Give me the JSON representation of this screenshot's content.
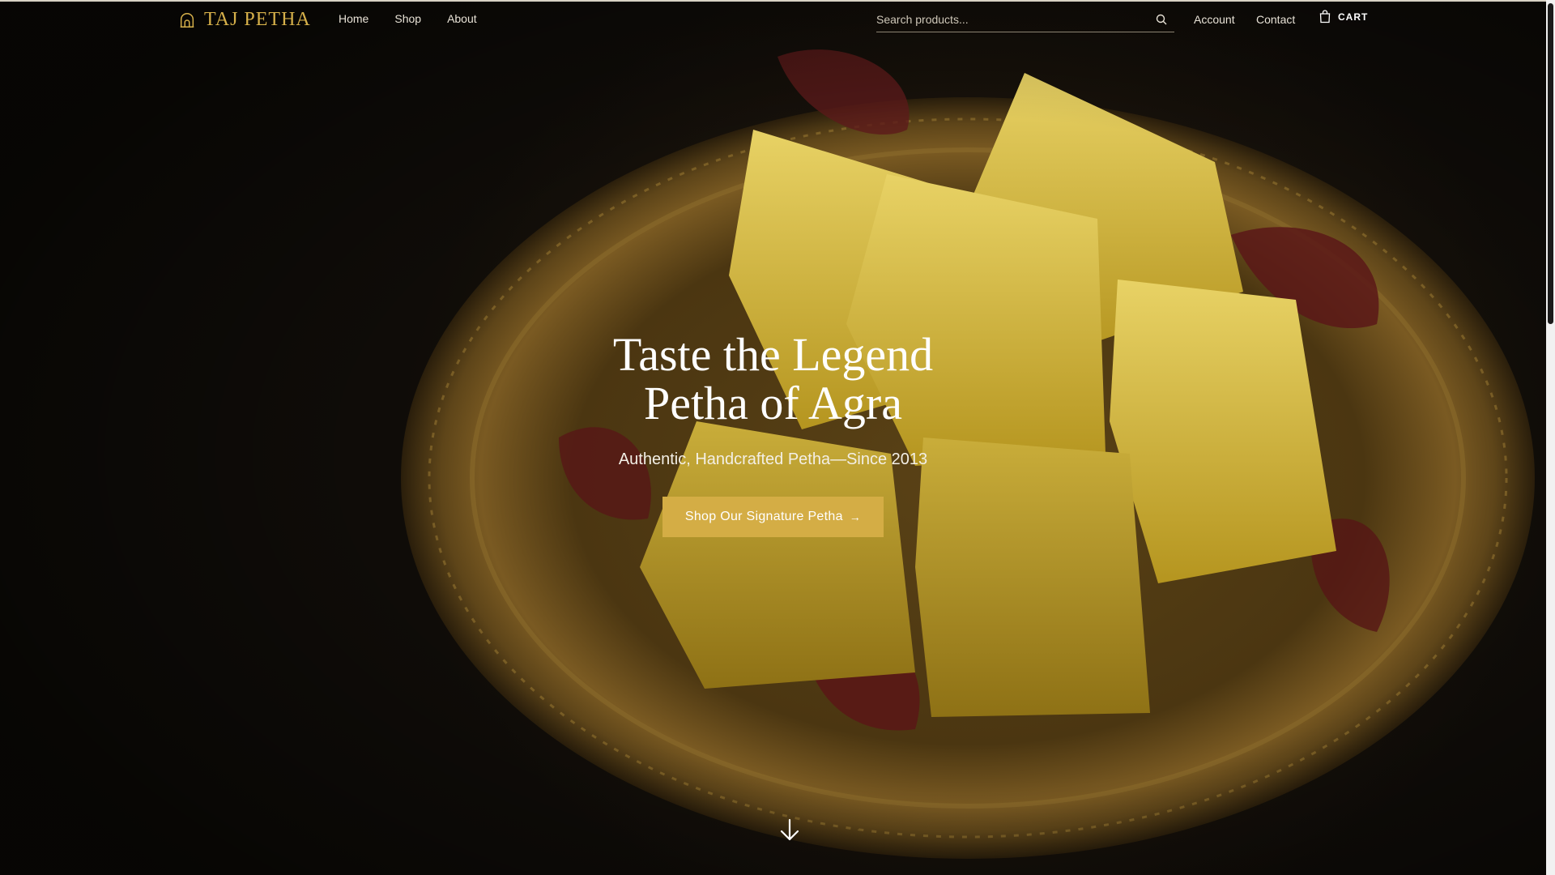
{
  "brand": {
    "name": "TAJ PETHA",
    "logo_icon": "temple-arch-icon",
    "color": "#d6b04a"
  },
  "nav": {
    "links": [
      {
        "label": "Home"
      },
      {
        "label": "Shop"
      },
      {
        "label": "About"
      }
    ]
  },
  "search": {
    "placeholder": "Search products...",
    "icon": "search-icon"
  },
  "header_right": {
    "account_label": "Account",
    "contact_label": "Contact",
    "cart_label": "CART",
    "cart_icon": "shopping-bag-icon"
  },
  "hero": {
    "headline_line1": "Taste the Legend",
    "headline_line2": "Petha of Agra",
    "subheadline": "Authentic, Handcrafted Petha—Since 2013",
    "cta_label": "Shop Our Signature Petha",
    "cta_arrow": "→",
    "cta_color": "#d4ad45",
    "scroll_icon": "arrow-down-icon"
  }
}
